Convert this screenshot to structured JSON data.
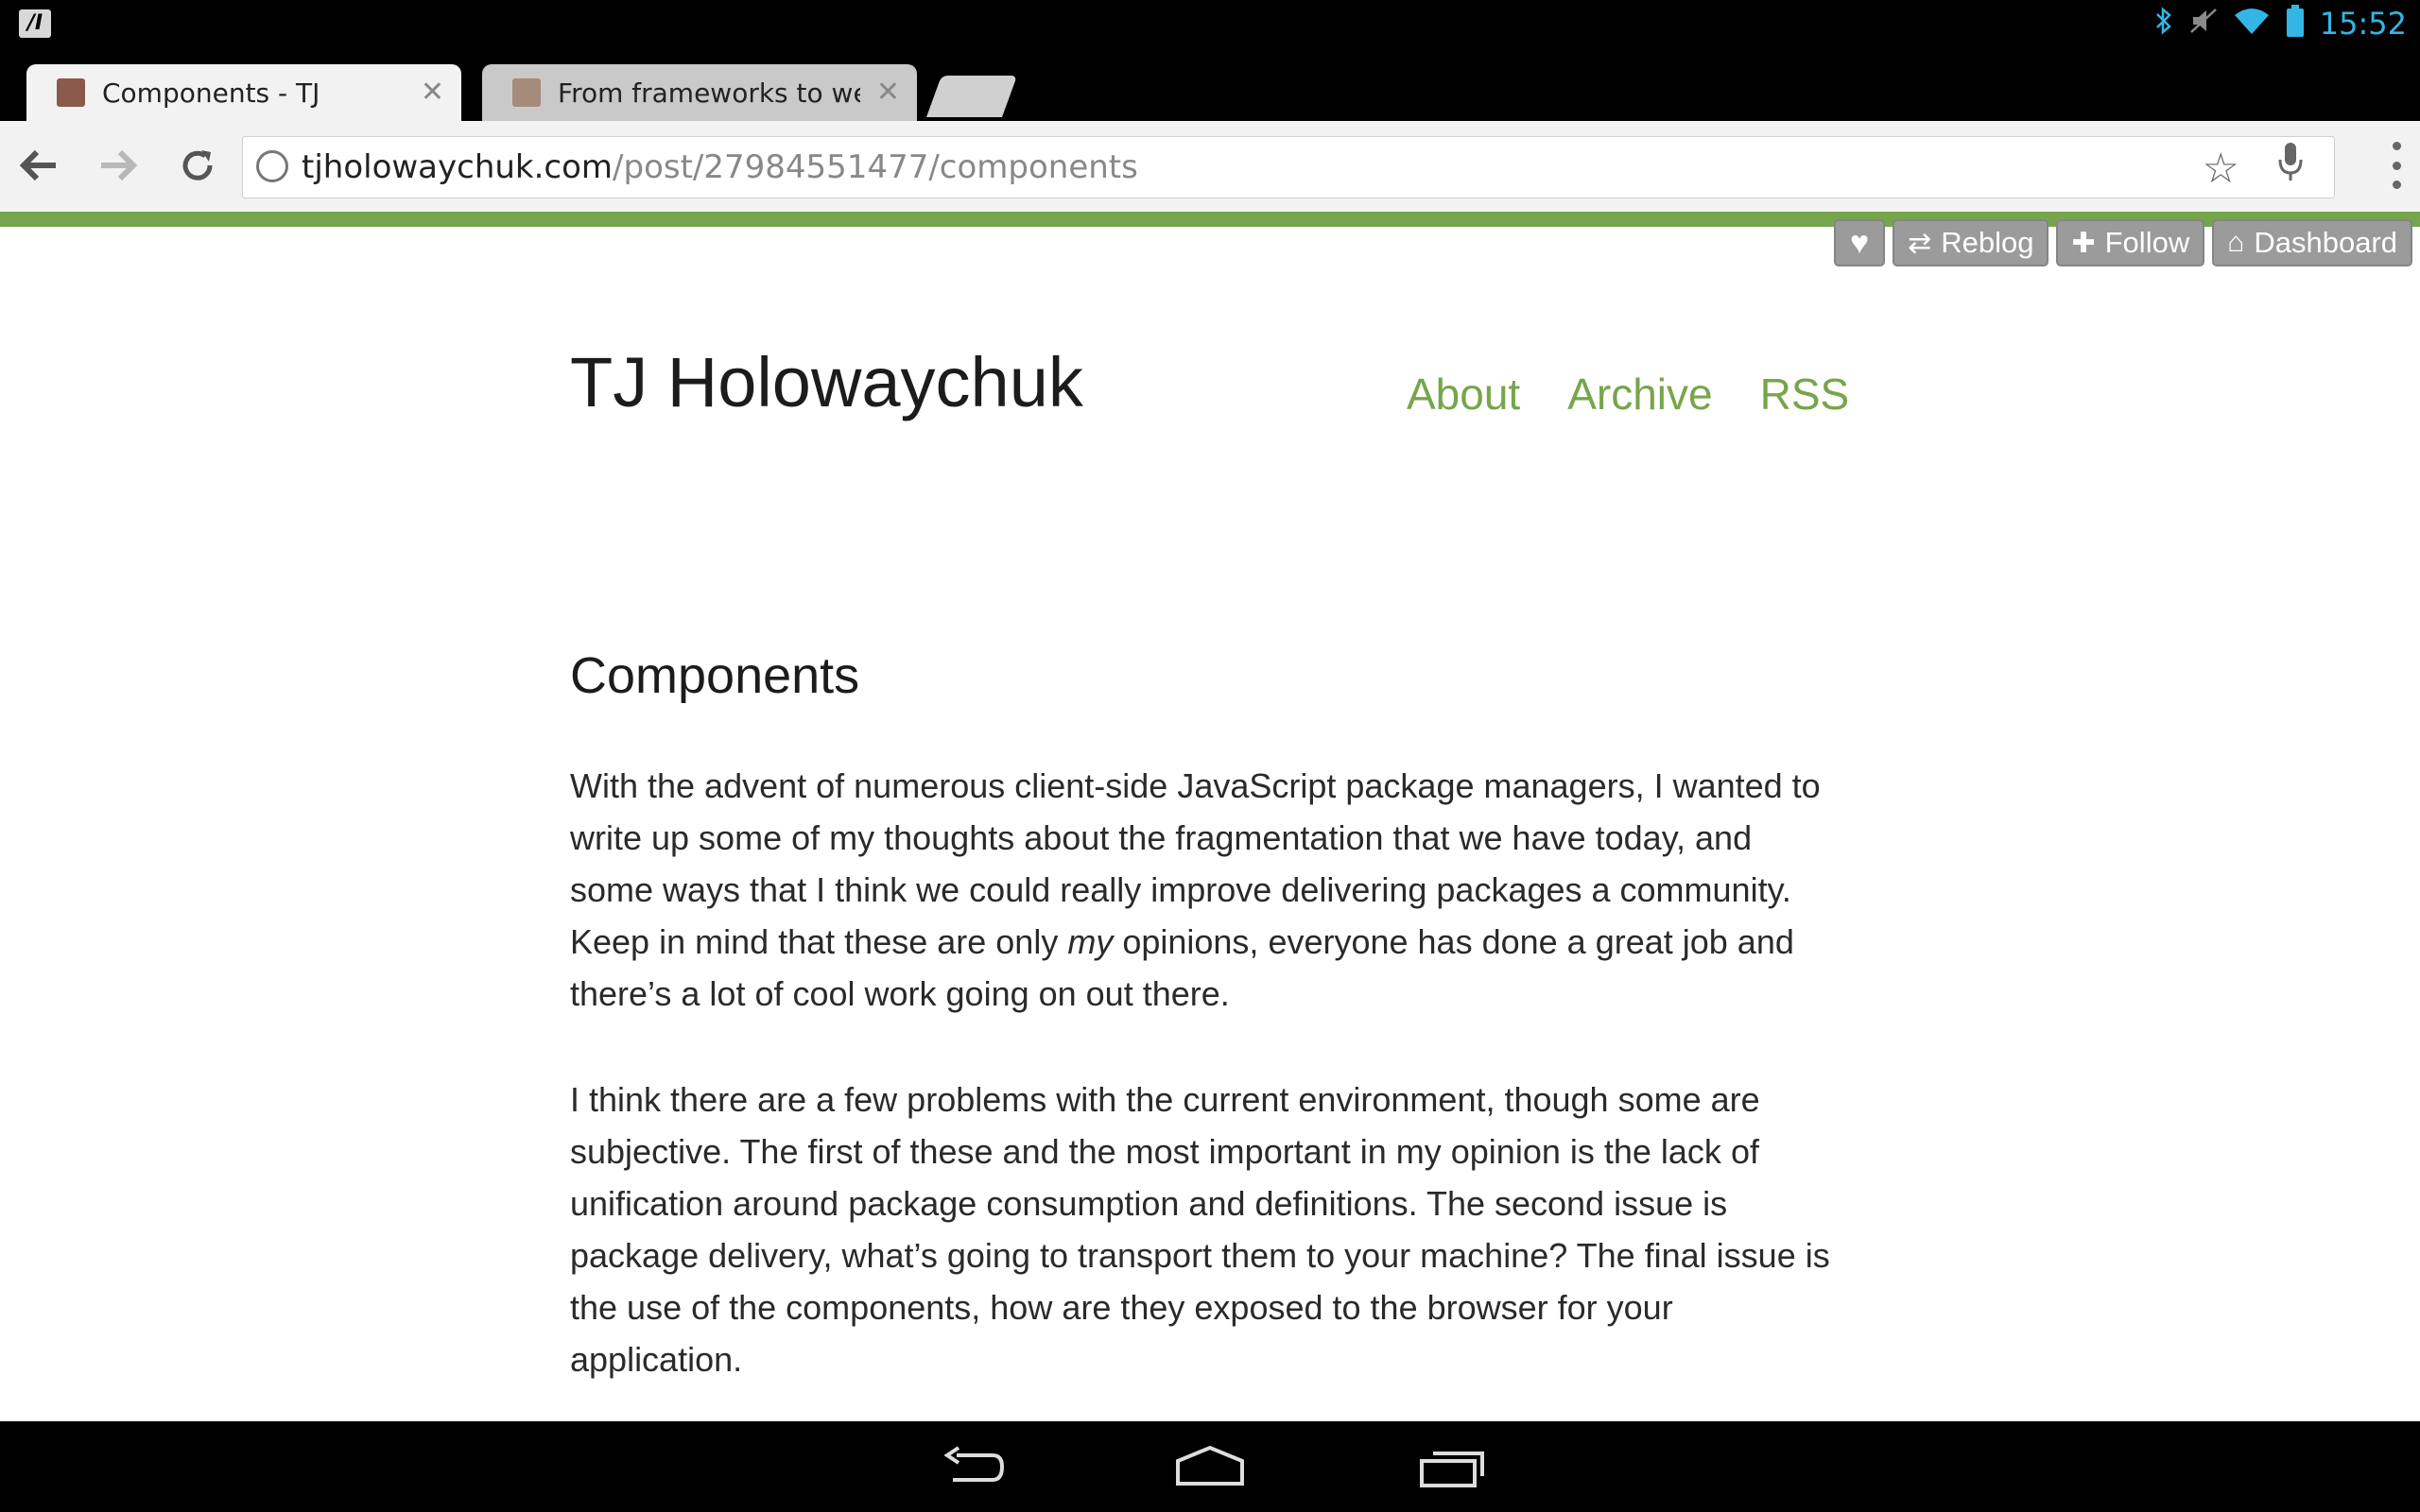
{
  "status_bar": {
    "time": "15:52",
    "icons": [
      "bluetooth-icon",
      "mute-icon",
      "wifi-icon",
      "battery-icon"
    ]
  },
  "tabs": [
    {
      "title": "Components - TJ",
      "active": true
    },
    {
      "title": "From frameworks to web",
      "active": false
    }
  ],
  "toolbar": {
    "url_host": "tjholowaychuk.com",
    "url_path": "/post/27984551477/components"
  },
  "tumblr_controls": {
    "reblog": "Reblog",
    "follow": "Follow",
    "dashboard": "Dashboard"
  },
  "blog": {
    "title": "TJ Holowaychuk",
    "nav": [
      "About",
      "Archive",
      "RSS"
    ]
  },
  "post": {
    "title": "Components",
    "p1_a": "With the advent of numerous client-side JavaScript package managers, I wanted to write up some of my thoughts about the fragmentation that we have today, and some ways that I think we could really improve delivering packages a community. Keep in mind that these are only ",
    "p1_em": "my",
    "p1_b": " opinions, everyone has done a great job and there’s a lot of cool work going on out there.",
    "p2": "I think there are a few problems with the current environment, though some are subjective. The first of these and the most important in my opinion is the lack of unification around package consumption and definitions. The second issue is package delivery, what’s going to transport them to your machine? The final issue is the use of the components, how are they exposed to the browser for your application."
  },
  "colors": {
    "accent_green": "#77a54b",
    "status_blue": "#33b5e5"
  }
}
